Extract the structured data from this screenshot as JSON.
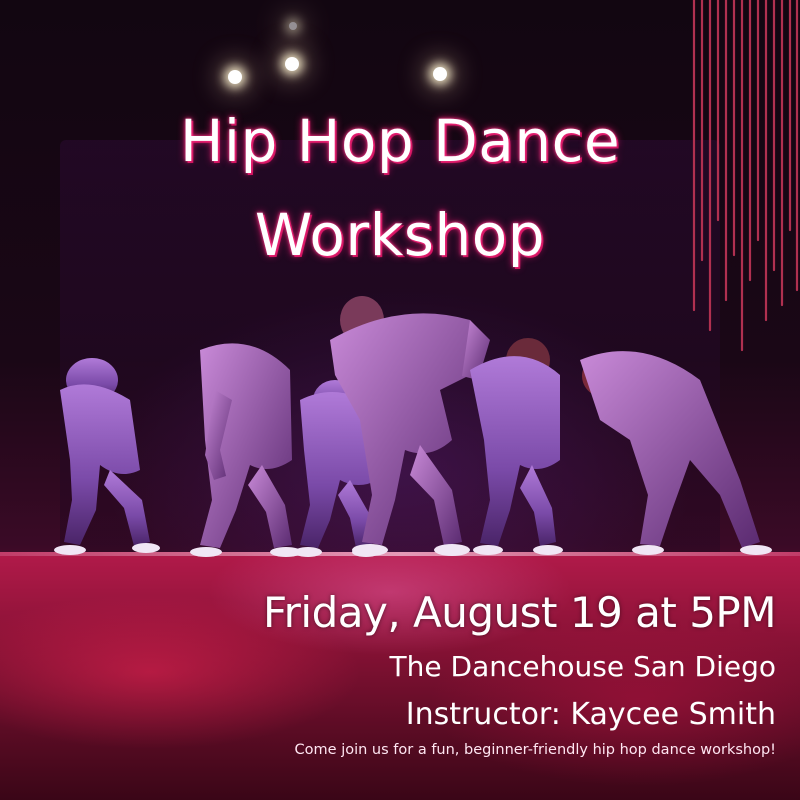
{
  "poster": {
    "title_line1": "Hip Hop Dance",
    "title_line2": "Workshop",
    "date": "Friday, August 19 at 5PM",
    "venue": "The Dancehouse San Diego",
    "instructor": "Instructor: Kaycee Smith",
    "tagline": "Come join us for a fun, beginner-friendly hip hop dance workshop!"
  },
  "colors": {
    "title_glow": "#e0186a",
    "stage_floor": "#b21a4a",
    "background": "#120611",
    "lines": "#b03050"
  },
  "image": {
    "photo": "dance-troupe-on-stage",
    "dancer_count": 6
  }
}
